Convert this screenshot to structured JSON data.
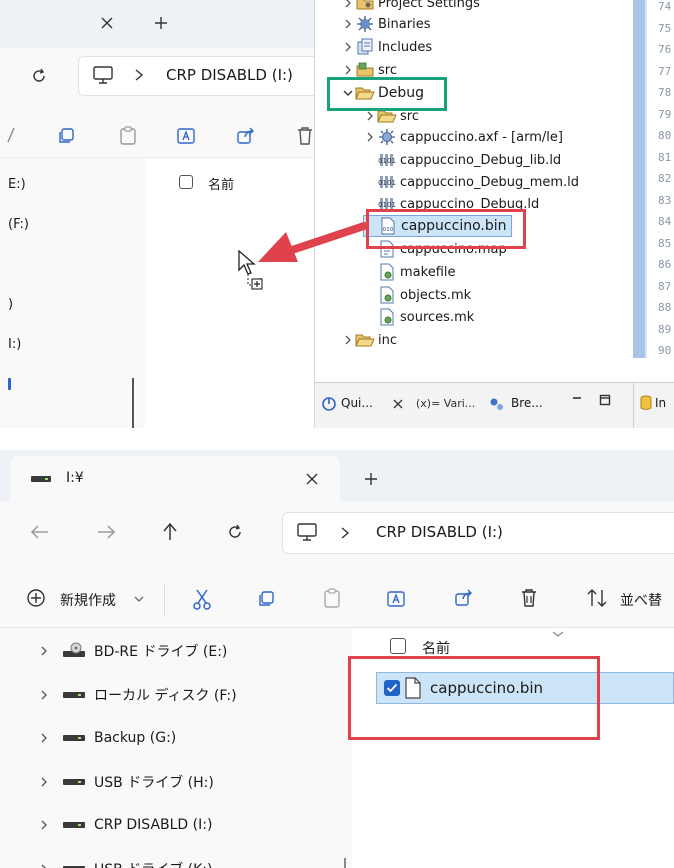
{
  "top": {
    "explorer": {
      "address_path": "CRP DISABLD (I:)",
      "column_name": "名前",
      "nav_items": [
        "E:)",
        "(F:)",
        ")",
        "I:)"
      ]
    },
    "project_tree": {
      "items": [
        {
          "label": "Project Settings",
          "level": 0,
          "chevron": "right"
        },
        {
          "label": "Binaries",
          "level": 0,
          "chevron": "right"
        },
        {
          "label": "Includes",
          "level": 0,
          "chevron": "right"
        },
        {
          "label": "src",
          "level": 0,
          "chevron": "right"
        },
        {
          "label": "Debug",
          "level": 0,
          "chevron": "down"
        },
        {
          "label": "src",
          "level": 1,
          "chevron": "right"
        },
        {
          "label": "cappuccino.axf - [arm/le]",
          "level": 1,
          "chevron": "right"
        },
        {
          "label": "cappuccino_Debug_lib.ld",
          "level": 1,
          "chevron": "none"
        },
        {
          "label": "cappuccino_Debug_mem.ld",
          "level": 1,
          "chevron": "none"
        },
        {
          "label": "cappuccino_Debug.ld",
          "level": 1,
          "chevron": "none"
        },
        {
          "label": "cappuccino.bin",
          "level": 1,
          "chevron": "none"
        },
        {
          "label": "cappuccino.map",
          "level": 1,
          "chevron": "none"
        },
        {
          "label": "makefile",
          "level": 1,
          "chevron": "none"
        },
        {
          "label": "objects.mk",
          "level": 1,
          "chevron": "none"
        },
        {
          "label": "sources.mk",
          "level": 1,
          "chevron": "none"
        },
        {
          "label": "inc",
          "level": 0,
          "chevron": "right"
        }
      ]
    },
    "line_numbers": [
      "74",
      "75",
      "76",
      "77",
      "78",
      "79",
      "80",
      "81",
      "82",
      "83",
      "84",
      "85",
      "86",
      "87",
      "88",
      "89",
      "90"
    ],
    "bottom_tabs": {
      "quick": "Qui...",
      "variables": "(x)= Vari...",
      "breakpoints": "Bre...",
      "right_tab": "In"
    }
  },
  "bottom": {
    "tab_title": "I:¥",
    "address_path": "CRP DISABLD (I:)",
    "toolbar": {
      "new_label": "新規作成",
      "sort_label": "並べ替"
    },
    "column_name": "名前",
    "file": "cappuccino.bin",
    "nav_items": [
      "BD-RE ドライブ (E:)",
      "ローカル ディスク (F:)",
      "Backup (G:)",
      "USB ドライブ (H:)",
      "CRP DISABLD (I:)",
      "USB ドライブ (K:)"
    ]
  },
  "colors": {
    "highlight_red": "#e0424b",
    "highlight_green": "#18a37a",
    "selection_blue": "#cce4f7",
    "checkbox_blue": "#1f63c6"
  }
}
